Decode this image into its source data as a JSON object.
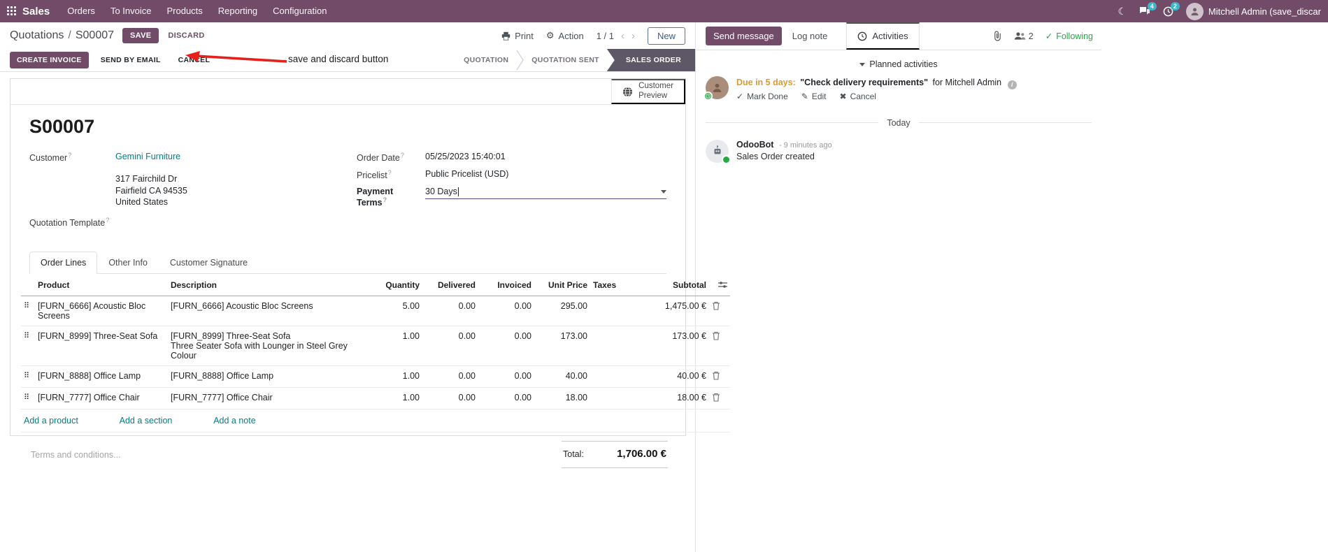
{
  "navbar": {
    "app_name": "Sales",
    "menus": [
      "Orders",
      "To Invoice",
      "Products",
      "Reporting",
      "Configuration"
    ],
    "messages_badge": "4",
    "activities_badge": "2",
    "user_name": "Mitchell Admin (save_discar"
  },
  "annotation": {
    "text": "save and discard button"
  },
  "control_panel": {
    "breadcrumb_parent": "Quotations",
    "breadcrumb_separator": "/",
    "breadcrumb_current": "S00007",
    "save": "SAVE",
    "discard": "DISCARD",
    "print": "Print",
    "action": "Action",
    "pager": "1 / 1",
    "prev": "‹",
    "next": "›",
    "new": "New"
  },
  "statusbar": {
    "create_invoice": "CREATE INVOICE",
    "send_by_email": "SEND BY EMAIL",
    "cancel": "CANCEL",
    "states": [
      {
        "label": "QUOTATION",
        "active": false
      },
      {
        "label": "QUOTATION SENT",
        "active": false
      },
      {
        "label": "SALES ORDER",
        "active": true
      }
    ]
  },
  "help_marker": "?",
  "sheet": {
    "preview_line1": "Customer",
    "preview_line2": "Preview",
    "title": "S00007",
    "fields": {
      "customer_label": "Customer",
      "customer_value": "Gemini Furniture",
      "address": [
        "317 Fairchild Dr",
        "Fairfield CA 94535",
        "United States"
      ],
      "quotation_template_label": "Quotation Template",
      "order_date_label": "Order Date",
      "order_date_value": "05/25/2023 15:40:01",
      "pricelist_label": "Pricelist",
      "pricelist_value": "Public Pricelist (USD)",
      "payment_terms_label": "Payment Terms",
      "payment_terms_value": "30 Days"
    },
    "tabs": [
      {
        "label": "Order Lines",
        "active": true
      },
      {
        "label": "Other Info",
        "active": false
      },
      {
        "label": "Customer Signature",
        "active": false
      }
    ],
    "order_lines": {
      "headers": {
        "product": "Product",
        "description": "Description",
        "quantity": "Quantity",
        "delivered": "Delivered",
        "invoiced": "Invoiced",
        "unit_price": "Unit Price",
        "taxes": "Taxes",
        "subtotal": "Subtotal"
      },
      "rows": [
        {
          "product": "[FURN_6666] Acoustic Bloc Screens",
          "description": "[FURN_6666] Acoustic Bloc Screens",
          "description2": "",
          "quantity": "5.00",
          "delivered": "0.00",
          "invoiced": "0.00",
          "unit_price": "295.00",
          "taxes": "",
          "subtotal": "1,475.00 €"
        },
        {
          "product": "[FURN_8999] Three-Seat Sofa",
          "description": "[FURN_8999] Three-Seat Sofa",
          "description2": "Three Seater Sofa with Lounger in Steel Grey Colour",
          "quantity": "1.00",
          "delivered": "0.00",
          "invoiced": "0.00",
          "unit_price": "173.00",
          "taxes": "",
          "subtotal": "173.00 €"
        },
        {
          "product": "[FURN_8888] Office Lamp",
          "description": "[FURN_8888] Office Lamp",
          "description2": "",
          "quantity": "1.00",
          "delivered": "0.00",
          "invoiced": "0.00",
          "unit_price": "40.00",
          "taxes": "",
          "subtotal": "40.00 €"
        },
        {
          "product": "[FURN_7777] Office Chair",
          "description": "[FURN_7777] Office Chair",
          "description2": "",
          "quantity": "1.00",
          "delivered": "0.00",
          "invoiced": "0.00",
          "unit_price": "18.00",
          "taxes": "",
          "subtotal": "18.00 €"
        }
      ],
      "add_product": "Add a product",
      "add_section": "Add a section",
      "add_note": "Add a note"
    },
    "terms_placeholder": "Terms and conditions...",
    "total_label": "Total:",
    "total_value": "1,706.00 €"
  },
  "chatter": {
    "send_message": "Send message",
    "log_note": "Log note",
    "activities_tab": "Activities",
    "followers_count": "2",
    "following": "Following",
    "planned_header": "Planned activities",
    "activity": {
      "due": "Due in 5 days:",
      "summary": "\"Check delivery requirements\"",
      "assignee": "for Mitchell Admin",
      "mark_done": "Mark Done",
      "edit": "Edit",
      "cancel": "Cancel"
    },
    "today": "Today",
    "message": {
      "author": "OdooBot",
      "time": "- 9 minutes ago",
      "body": "Sales Order created"
    }
  },
  "colors": {
    "primary": "#714B67",
    "link_teal": "#017e84",
    "status_active": "#5e5765",
    "annotation_red": "#e5211e",
    "following_green": "#28a745",
    "due_orange": "#d89b34",
    "badge_cyan": "#3cb5cd"
  }
}
